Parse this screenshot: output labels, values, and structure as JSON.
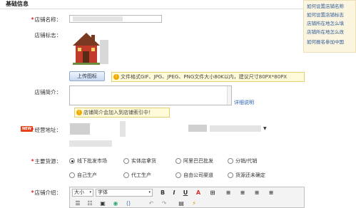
{
  "section": {
    "title": "基础信息"
  },
  "form": {
    "shop_name_label": "店铺名称：",
    "shop_logo_label": "店铺标志：",
    "upload_button": "上传图标",
    "upload_tip": "文件格式GIF、JPG、JPEG、PNG文件大小80K以内，建议尺寸80PX*80PX",
    "shop_intro_label": "店铺简介：",
    "detail_link": "详细说明",
    "intro_tip": "店铺简介会加入到店铺索引中！",
    "address_label": "经营地址：",
    "new_badge": "NEW",
    "select_arrow": "▼",
    "supply_label": "主要货源：",
    "supply_options": [
      {
        "label": "线下批发市场",
        "checked": true
      },
      {
        "label": "实体店拿货",
        "checked": false
      },
      {
        "label": "阿里巴巴批发",
        "checked": false
      },
      {
        "label": "分销/代销",
        "checked": false
      },
      {
        "label": "自己生产",
        "checked": false
      },
      {
        "label": "代工生产",
        "checked": false
      },
      {
        "label": "自由公司渠道",
        "checked": false
      },
      {
        "label": "货源还未确定",
        "checked": false
      }
    ],
    "shop_desc_label": "店铺介绍："
  },
  "editor": {
    "font_size": "大小",
    "font_family": "字体",
    "dropdown_arrow": "▾",
    "bold": "B",
    "italic": "I",
    "underline": "U",
    "toolbar_row1": [
      "A",
      "⊞",
      "≡",
      "≡",
      "≡",
      "≡"
    ],
    "toolbar_row2": [
      "☰",
      "☷",
      "▣",
      "◉",
      "⟨⟩",
      "↶",
      "↷",
      "▤",
      "⚡"
    ]
  },
  "side_panel": {
    "links": [
      "如何设置店铺名称",
      "如何设置店铺标志",
      "店铺所在地怎么填",
      "店铺所在地怎么改",
      "如何报名参加中国"
    ]
  },
  "colors": {
    "required": "#e02020",
    "link": "#2a62b5",
    "tip_bg": "#fffbd8",
    "badge": "#e8411b"
  }
}
